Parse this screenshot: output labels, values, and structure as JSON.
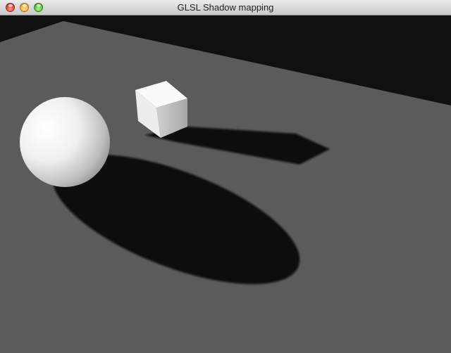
{
  "window": {
    "title": "GLSL Shadow mapping"
  },
  "scene": {
    "objects": [
      "sphere",
      "cube",
      "ground-plane"
    ],
    "colors": {
      "background": "#101010",
      "ground": "#5b5b5b",
      "shadow": "#111111",
      "object": "#f2f2f2"
    }
  }
}
